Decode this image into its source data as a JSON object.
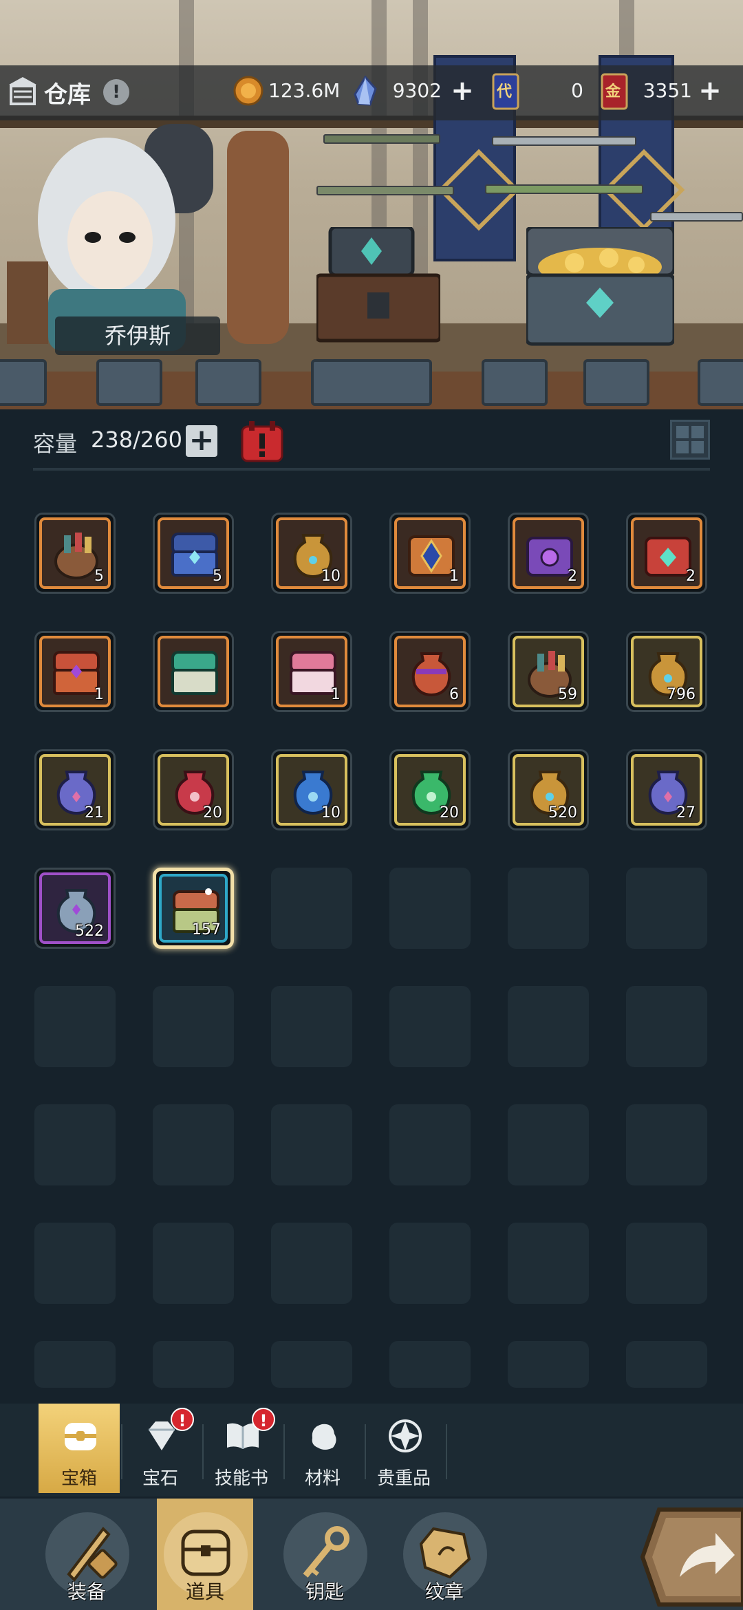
{
  "header": {
    "title": "仓库",
    "help_icon": "!",
    "currencies": [
      {
        "name": "gold-coin",
        "value": "123.6M",
        "has_add": false
      },
      {
        "name": "crystal",
        "value": "9302",
        "has_add": true
      },
      {
        "name": "blue-card",
        "value": "0",
        "has_add": false
      },
      {
        "name": "red-card",
        "value": "3351",
        "has_add": true
      }
    ],
    "card_blue_text": "代",
    "card_red_text": "金"
  },
  "hero": {
    "name": "乔伊斯"
  },
  "capacity": {
    "label": "容量",
    "value": "238/260",
    "add_label": "+"
  },
  "colors": {
    "orange": "#e08a3c",
    "gold": "#d8c05e",
    "purple": "#a050c8",
    "blue": "#2ea8c8",
    "active_tab": "#d7a945",
    "badge": "#d6262e"
  },
  "inventory": {
    "items": [
      {
        "icon": "bag-icon",
        "rarity": "orange",
        "count": "5"
      },
      {
        "icon": "blue-chest-icon",
        "rarity": "orange",
        "count": "5"
      },
      {
        "icon": "gold-jar-icon",
        "rarity": "orange",
        "count": "10"
      },
      {
        "icon": "crest-chest-icon",
        "rarity": "orange",
        "count": "1"
      },
      {
        "icon": "purple-crest-icon",
        "rarity": "orange",
        "count": "2"
      },
      {
        "icon": "red-crest-icon",
        "rarity": "orange",
        "count": "2"
      },
      {
        "icon": "red-chest-icon",
        "rarity": "orange",
        "count": "1"
      },
      {
        "icon": "green-chest-icon",
        "rarity": "orange",
        "count": ""
      },
      {
        "icon": "pink-chest-icon",
        "rarity": "orange",
        "count": "1"
      },
      {
        "icon": "orange-jar-icon",
        "rarity": "orange",
        "count": "6"
      },
      {
        "icon": "bag-icon",
        "rarity": "gold",
        "count": "59"
      },
      {
        "icon": "gold-jar-icon",
        "rarity": "gold",
        "count": "796"
      },
      {
        "icon": "purple-jar-icon",
        "rarity": "gold",
        "count": "21"
      },
      {
        "icon": "red-jar-icon",
        "rarity": "gold",
        "count": "20"
      },
      {
        "icon": "blue-jar-icon",
        "rarity": "gold",
        "count": "10"
      },
      {
        "icon": "green-jar-icon",
        "rarity": "gold",
        "count": "20"
      },
      {
        "icon": "gold-jar-icon",
        "rarity": "gold",
        "count": "520"
      },
      {
        "icon": "purple-jar-icon",
        "rarity": "gold",
        "count": "27"
      },
      {
        "icon": "silver-jar-icon",
        "rarity": "purple",
        "count": "522"
      },
      {
        "icon": "wooden-chest-icon",
        "rarity": "blue",
        "count": "157",
        "selected": true
      }
    ],
    "total_slots": 48
  },
  "subtabs": [
    {
      "label": "宝箱",
      "icon": "chest-icon",
      "active": true,
      "badge": false
    },
    {
      "label": "宝石",
      "icon": "gem-icon",
      "active": false,
      "badge": true
    },
    {
      "label": "技能书",
      "icon": "book-icon",
      "active": false,
      "badge": true
    },
    {
      "label": "材料",
      "icon": "material-icon",
      "active": false,
      "badge": false
    },
    {
      "label": "贵重品",
      "icon": "valuable-icon",
      "active": false,
      "badge": false
    }
  ],
  "badge_text": "!",
  "bottomnav": [
    {
      "label": "装备",
      "icon": "equipment-icon",
      "active": false
    },
    {
      "label": "道具",
      "icon": "item-chest-icon",
      "active": true
    },
    {
      "label": "钥匙",
      "icon": "key-icon",
      "active": false
    },
    {
      "label": "纹章",
      "icon": "emblem-icon",
      "active": false
    }
  ]
}
